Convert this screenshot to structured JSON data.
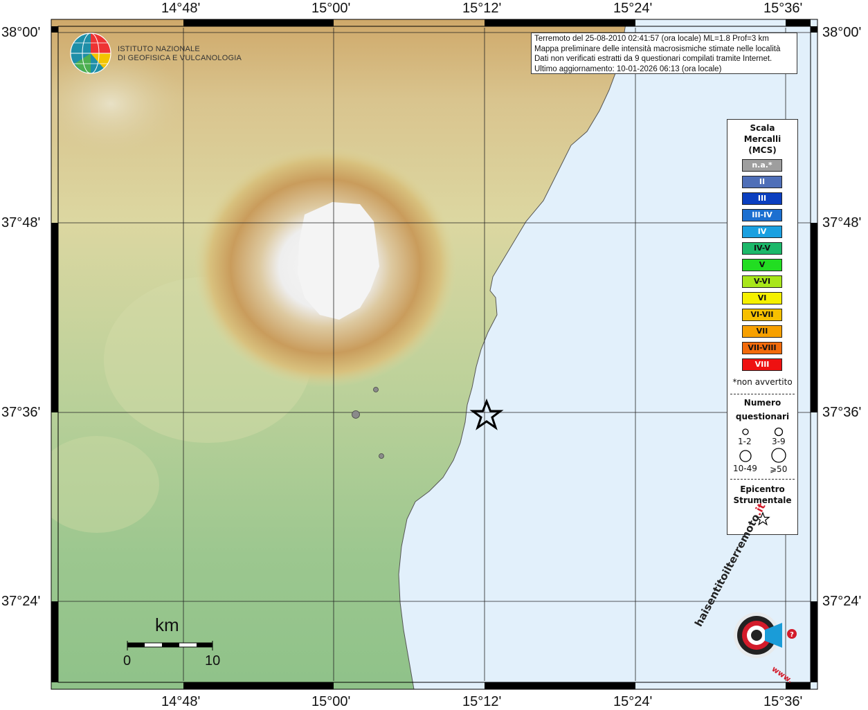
{
  "axes": {
    "lon_labels": [
      "14°48'",
      "15°00'",
      "15°12'",
      "15°24'",
      "15°36'"
    ],
    "lat_labels": [
      "38°00'",
      "37°48'",
      "37°36'",
      "37°24'"
    ]
  },
  "logo": {
    "line1": "ISTITUTO NAZIONALE",
    "line2": "DI GEOFISICA E VULCANOLOGIA"
  },
  "info": {
    "line1": "Terremoto del 25-08-2010 02:41:57 (ora locale) ML=1.8 Prof=3 km",
    "line2": "Mappa preliminare delle intensità macrosismiche stimate nelle località",
    "line3": "Dati non verificati estratti da 9 questionari compilati tramite Internet.",
    "line4": "Ultimo aggiornamento: 10-01-2026 06:13 (ora locale)"
  },
  "legend": {
    "title1": "Scala",
    "title2": "Mercalli",
    "title3": "(MCS)",
    "items": [
      {
        "label": "n.a.*",
        "color": "#9e9e9e",
        "text_color": "#ffffff"
      },
      {
        "label": "II",
        "color": "#4f6fb8",
        "text_color": "#ffffff"
      },
      {
        "label": "III",
        "color": "#0b3fc0",
        "text_color": "#ffffff"
      },
      {
        "label": "III-IV",
        "color": "#1c6fd0",
        "text_color": "#ffffff"
      },
      {
        "label": "IV",
        "color": "#1aa0e0",
        "text_color": "#ffffff"
      },
      {
        "label": "IV-V",
        "color": "#1cb86a",
        "text_color": "#111111"
      },
      {
        "label": "V",
        "color": "#22dd22",
        "text_color": "#111111"
      },
      {
        "label": "V-VI",
        "color": "#a8e61a",
        "text_color": "#111111"
      },
      {
        "label": "VI",
        "color": "#f5f000",
        "text_color": "#111111"
      },
      {
        "label": "VI-VII",
        "color": "#f7c000",
        "text_color": "#111111"
      },
      {
        "label": "VII",
        "color": "#f7a000",
        "text_color": "#111111"
      },
      {
        "label": "VII-VIII",
        "color": "#f26a0a",
        "text_color": "#111111"
      },
      {
        "label": "VIII",
        "color": "#ee1111",
        "text_color": "#ffffff"
      }
    ],
    "note": "*non avvertito",
    "count_title1": "Numero",
    "count_title2": "questionari",
    "size_labels": [
      "1-2",
      "3-9",
      "10-49",
      "⩾50"
    ],
    "epicenter_title1": "Epicentro",
    "epicenter_title2": "Strumentale"
  },
  "scalebar": {
    "unit": "km",
    "min": "0",
    "max": "10"
  },
  "watermark": {
    "text1": "haisentito",
    "text2": "ilterremoto",
    "text3": ".it",
    "text4": "www."
  },
  "colors": {
    "sea": "#e2f0fb",
    "grid": "#222222",
    "point": "#8a8a8a",
    "summit": "#f4f4f4"
  }
}
